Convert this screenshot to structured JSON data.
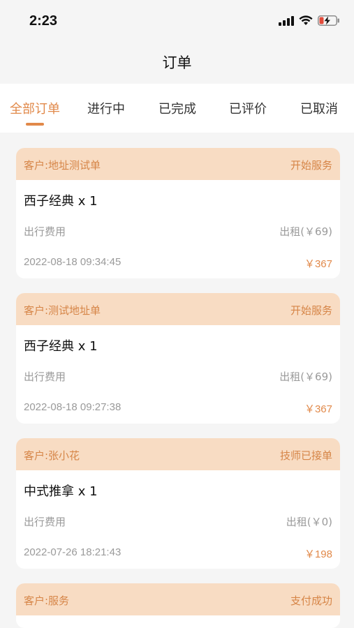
{
  "status_bar": {
    "time": "2:23"
  },
  "nav": {
    "title": "订单"
  },
  "tabs": [
    {
      "label": "全部订单"
    },
    {
      "label": "进行中"
    },
    {
      "label": "已完成"
    },
    {
      "label": "已评价"
    },
    {
      "label": "已取消"
    }
  ],
  "active_tab": "全部订单",
  "colors": {
    "accent": "#e1894a",
    "card_header_bg": "#f8dcc3"
  },
  "orders": [
    {
      "customer": "客户:地址测试单",
      "status": "开始服务",
      "product": "西子经典 x 1",
      "fee_label": "出行费用",
      "fee_value": "出租(￥69)",
      "time": "2022-08-18 09:34:45",
      "price": "￥367"
    },
    {
      "customer": "客户:测试地址单",
      "status": "开始服务",
      "product": "西子经典 x 1",
      "fee_label": "出行费用",
      "fee_value": "出租(￥69)",
      "time": "2022-08-18 09:27:38",
      "price": "￥367"
    },
    {
      "customer": "客户:张小花",
      "status": "技师已接单",
      "product": "中式推拿 x 1",
      "fee_label": "出行费用",
      "fee_value": "出租(￥0)",
      "time": "2022-07-26 18:21:43",
      "price": "￥198"
    },
    {
      "customer": "客户:服务",
      "status": "支付成功",
      "product": "",
      "fee_label": "",
      "fee_value": "",
      "time": "",
      "price": ""
    }
  ]
}
